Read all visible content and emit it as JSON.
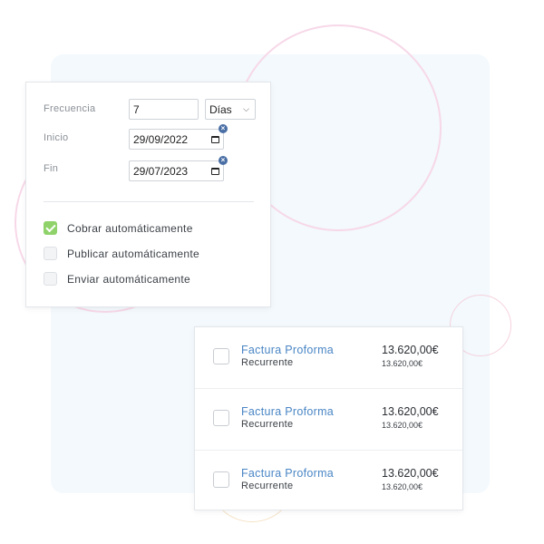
{
  "recurrence_settings": {
    "frequency": {
      "label": "Frecuencia",
      "value": "7",
      "unit": "Días"
    },
    "start": {
      "label": "Inicio",
      "value": "29/09/2022"
    },
    "end": {
      "label": "Fin",
      "value": "29/07/2023"
    },
    "options": [
      {
        "label": "Cobrar automáticamente",
        "checked": true
      },
      {
        "label": "Publicar automáticamente",
        "checked": false
      },
      {
        "label": "Enviar automáticamente",
        "checked": false
      }
    ]
  },
  "invoices": [
    {
      "title": "Factura Proforma",
      "subtitle": "Recurrente",
      "amount": "13.620,00€",
      "amount_small": "13.620,00€"
    },
    {
      "title": "Factura Proforma",
      "subtitle": "Recurrente",
      "amount": "13.620,00€",
      "amount_small": "13.620,00€"
    },
    {
      "title": "Factura Proforma",
      "subtitle": "Recurrente",
      "amount": "13.620,00€",
      "amount_small": "13.620,00€"
    }
  ],
  "colors": {
    "accent_link": "#4a86c5",
    "check_green": "#8fd26a",
    "panel_bg": "#f3f9fd",
    "clear_badge": "#4a6fa5"
  }
}
